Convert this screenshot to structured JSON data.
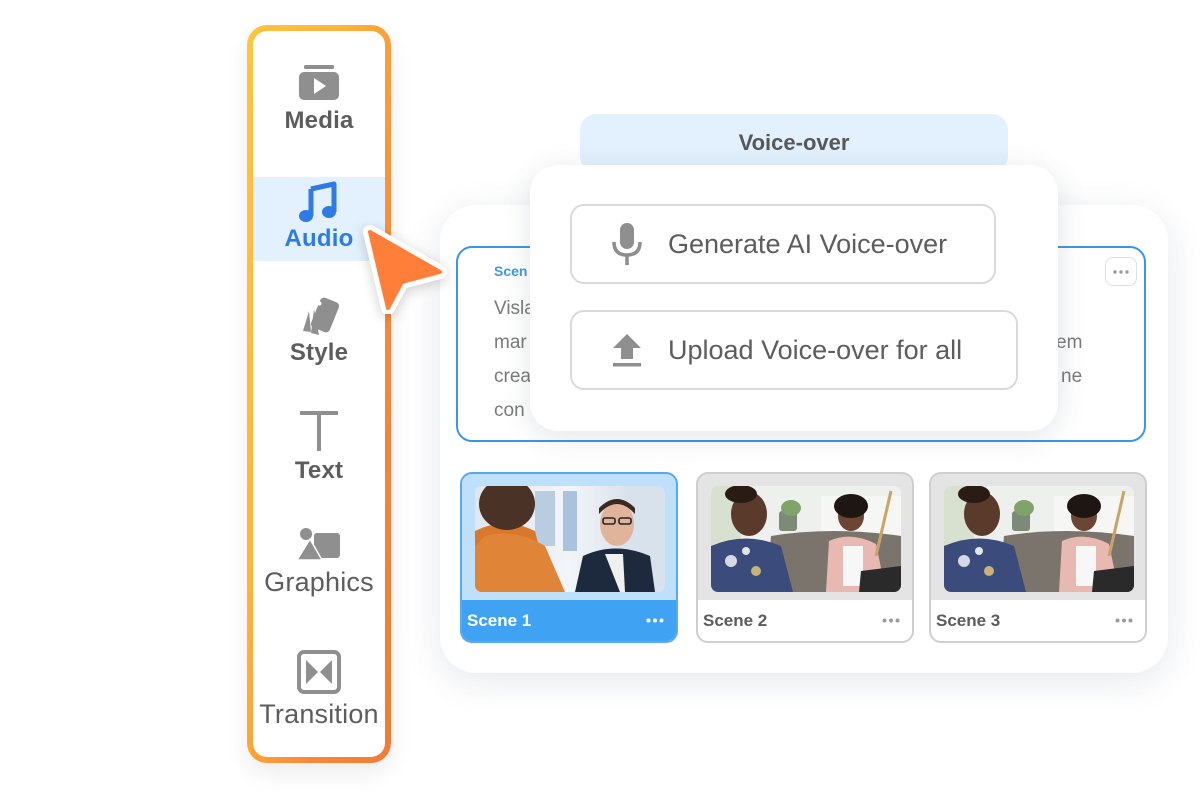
{
  "toolbar": {
    "items": [
      {
        "label": "Media",
        "icon": "media-play-icon",
        "active": false
      },
      {
        "label": "Audio",
        "icon": "music-note-icon",
        "active": true
      },
      {
        "label": "Style",
        "icon": "style-swatch-icon",
        "active": false
      },
      {
        "label": "Text",
        "icon": "text-t-icon",
        "active": false
      },
      {
        "label": "Graphics",
        "icon": "shapes-icon",
        "active": false
      },
      {
        "label": "Transition",
        "icon": "transition-bowtie-icon",
        "active": false
      }
    ]
  },
  "voiceover": {
    "tab_label": "Voice-over",
    "options": [
      {
        "label": "Generate AI Voice-over",
        "icon": "microphone-icon"
      },
      {
        "label": "Upload Voice-over for all",
        "icon": "upload-icon"
      }
    ]
  },
  "script_card": {
    "scene_label": "Scen",
    "text_lines_left": [
      "Visla",
      "mar",
      "crea",
      "con"
    ],
    "text_lines_right": [
      "em",
      "ne"
    ],
    "more_icon": "more-horizontal-icon"
  },
  "scenes": [
    {
      "name": "Scene 1",
      "selected": true
    },
    {
      "name": "Scene 2",
      "selected": false
    },
    {
      "name": "Scene 3",
      "selected": false
    }
  ],
  "colors": {
    "accent_blue": "#3b95ea",
    "active_bg": "#e2f1fd",
    "active_text": "#2f7be6",
    "frame_gradient_start": "#ffc43d",
    "frame_gradient_end": "#f27a33",
    "cursor": "#ff7f3a",
    "icon_gray": "#8f8f8f",
    "label_gray": "#5d5d5d"
  }
}
